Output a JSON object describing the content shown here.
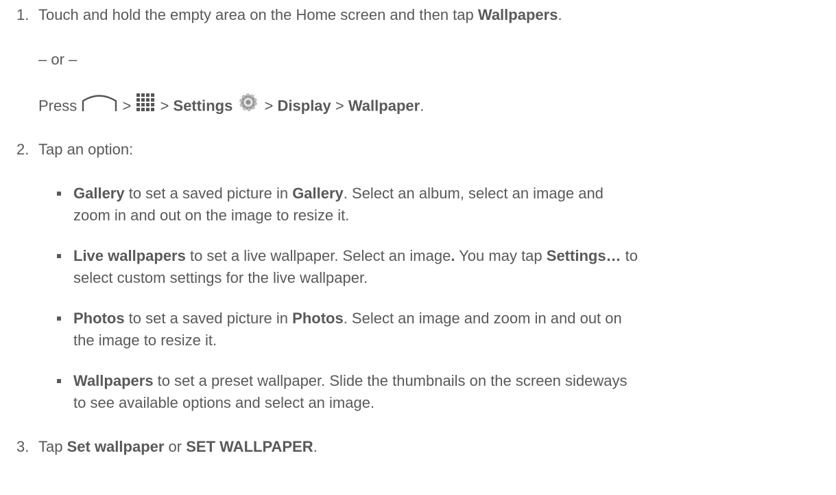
{
  "steps": [
    {
      "number": "1.",
      "text_a": "Touch and hold the empty area on the Home screen and then tap ",
      "bold_a": "Wallpapers",
      "end": "."
    },
    {
      "number": "2.",
      "text": "Tap an option:"
    },
    {
      "number": "3.",
      "text_a": "Tap ",
      "bold_a": "Set wallpaper",
      "text_b": " or ",
      "bold_b": "SET WALLPAPER",
      "end": "."
    }
  ],
  "alt": {
    "or_text": "– or –",
    "press": "Press ",
    "sep": " > ",
    "settings": "Settings",
    "display": "Display",
    "wallpaper": "Wallpaper",
    "end": "."
  },
  "options": [
    {
      "bold": "Gallery",
      "text_a": " to set a saved picture in ",
      "bold_b": "Gallery",
      "text_b": ". Select an album, select an image and",
      "line2": "zoom in and out on the image to resize it."
    },
    {
      "bold": "Live wallpapers",
      "text_a": " to set a live wallpaper. Select an image",
      "bold_dot": ".",
      "text_b": " You may tap ",
      "bold_b": "Settings…",
      "text_c": " to",
      "line2": "select custom settings for the live wallpaper."
    },
    {
      "bold": "Photos",
      "text_a": " to set a saved picture in ",
      "bold_b": "Photos",
      "text_b": ". Select an image and zoom in and out on",
      "line2": "the image to resize it."
    },
    {
      "bold": "Wallpapers",
      "text_a": " to set a preset wallpaper. Slide the thumbnails on the screen sideways",
      "line2": "to see available options and select an image."
    }
  ],
  "icons": [
    "home-icon",
    "apps-grid-icon",
    "settings-gear-icon"
  ]
}
